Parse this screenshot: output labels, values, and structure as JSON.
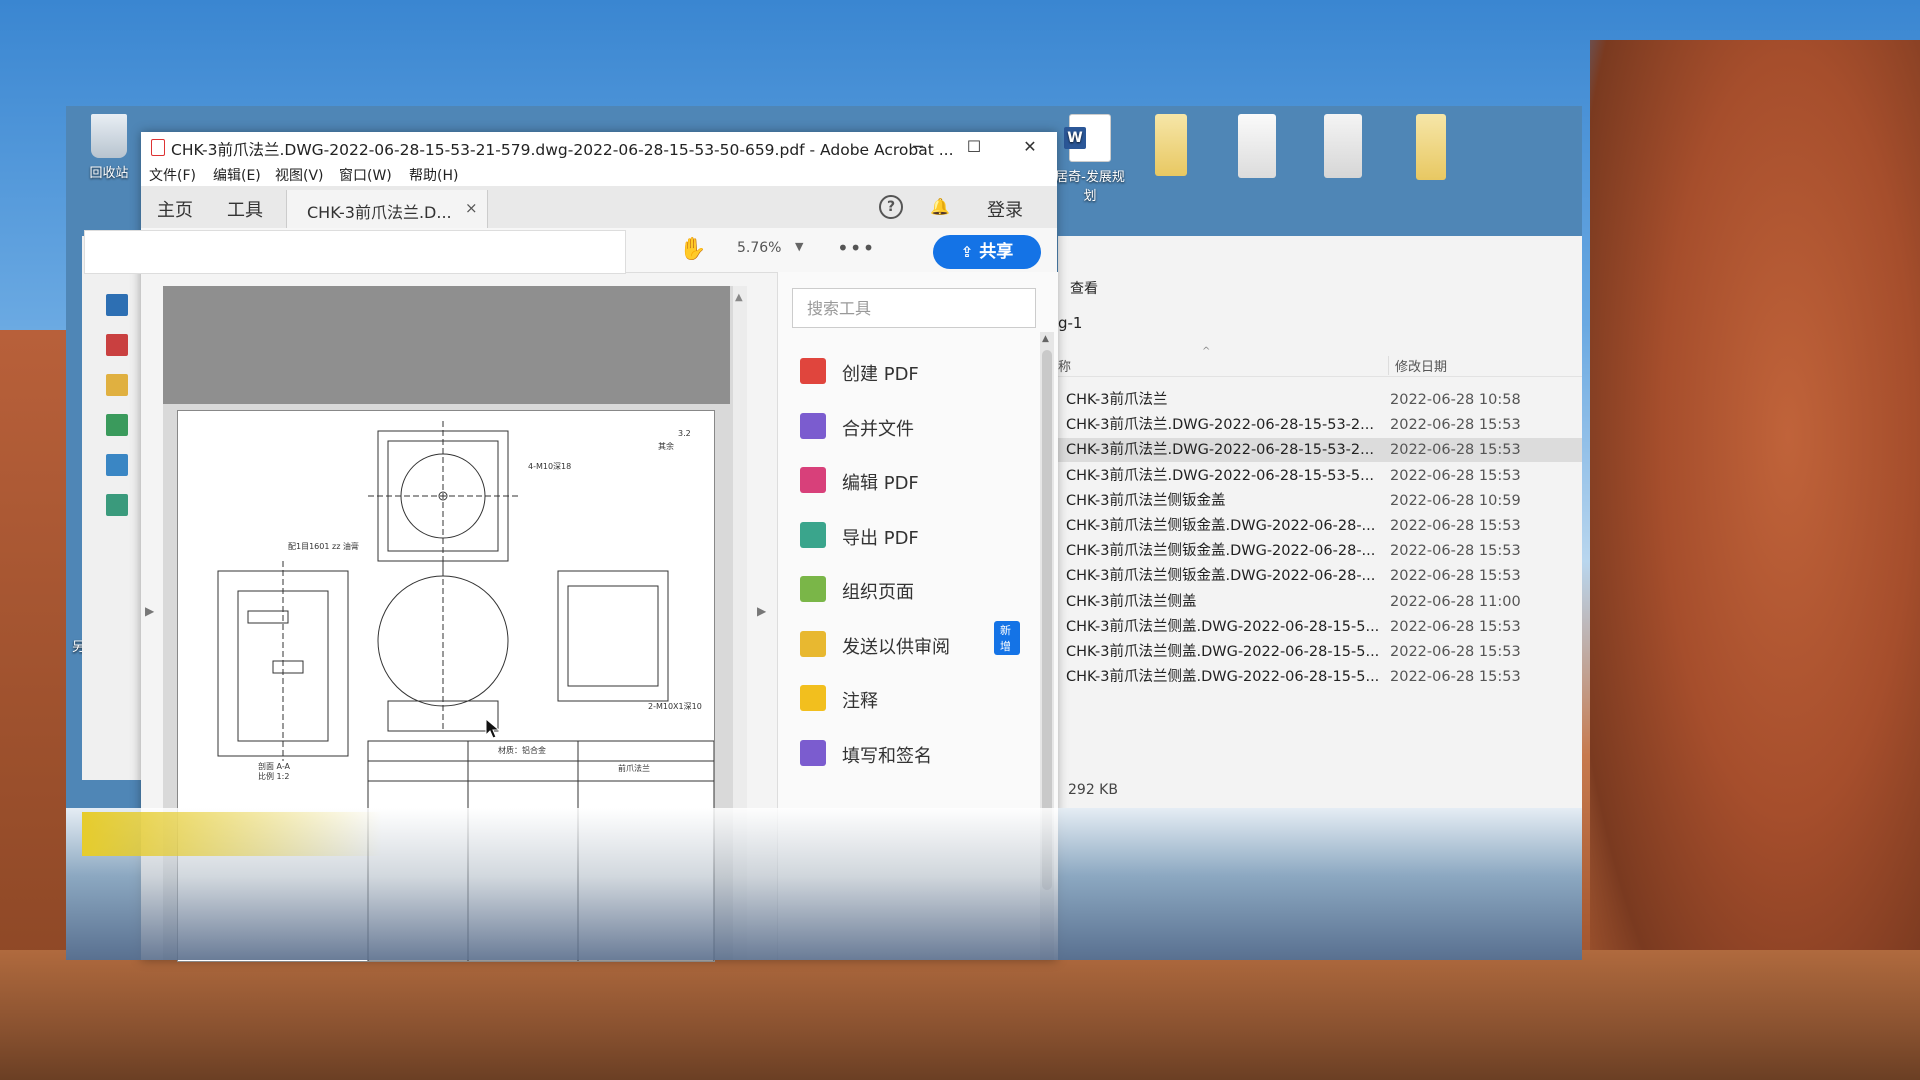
{
  "desktop": {
    "icons": [
      {
        "label": "回收站"
      },
      {
        "label": "居奇-发展规划"
      }
    ],
    "partial_label": "另"
  },
  "acrobat": {
    "window_title": "CHK-3前爪法兰.DWG-2022-06-28-15-53-21-579.dwg-2022-06-28-15-53-50-659.pdf - Adobe Acrobat ...",
    "menu": [
      "文件(F)",
      "编辑(E)",
      "视图(V)",
      "窗口(W)",
      "帮助(H)"
    ],
    "tabs": {
      "home": "主页",
      "tools": "工具",
      "doc": "CHK-3前爪法兰.D...",
      "close": "×"
    },
    "login": "登录",
    "help": "?",
    "toolbar": {
      "zoom": "5.76%",
      "more": "•••",
      "share": "共享"
    },
    "tools_pane": {
      "search_placeholder": "搜索工具",
      "new_badge": "新增",
      "items": [
        {
          "label": "创建 PDF",
          "color": "#e0453d"
        },
        {
          "label": "合并文件",
          "color": "#7b5ccf"
        },
        {
          "label": "编辑 PDF",
          "color": "#d8407a"
        },
        {
          "label": "导出 PDF",
          "color": "#3aa58c"
        },
        {
          "label": "组织页面",
          "color": "#7ab648"
        },
        {
          "label": "发送以供审阅",
          "color": "#e8b830"
        },
        {
          "label": "注释",
          "color": "#f2bf1e"
        },
        {
          "label": "填写和签名",
          "color": "#7b5ccf"
        }
      ]
    },
    "drawing_notes": {
      "n1": "4-M10深18",
      "n2": "2-M10X1深10",
      "n3": "剖面 A-A",
      "n4": "比例 1:2",
      "n5": "前爪法兰",
      "n6": "材质：铝合金",
      "n7": "其余",
      "n8": "配1目1601 zz 油膏",
      "n9": "3.2"
    }
  },
  "explorer": {
    "view_tab": "查看",
    "path_tail": "g-1",
    "col_name": "称",
    "col_date": "修改日期",
    "files": [
      {
        "name": "CHK-3前爪法兰",
        "date": "2022-06-28 10:58"
      },
      {
        "name": "CHK-3前爪法兰.DWG-2022-06-28-15-53-2...",
        "date": "2022-06-28 15:53"
      },
      {
        "name": "CHK-3前爪法兰.DWG-2022-06-28-15-53-2...",
        "date": "2022-06-28 15:53"
      },
      {
        "name": "CHK-3前爪法兰.DWG-2022-06-28-15-53-5...",
        "date": "2022-06-28 15:53"
      },
      {
        "name": "CHK-3前爪法兰侧钣金盖",
        "date": "2022-06-28 10:59"
      },
      {
        "name": "CHK-3前爪法兰侧钣金盖.DWG-2022-06-28-...",
        "date": "2022-06-28 15:53"
      },
      {
        "name": "CHK-3前爪法兰侧钣金盖.DWG-2022-06-28-...",
        "date": "2022-06-28 15:53"
      },
      {
        "name": "CHK-3前爪法兰侧钣金盖.DWG-2022-06-28-...",
        "date": "2022-06-28 15:53"
      },
      {
        "name": "CHK-3前爪法兰侧盖",
        "date": "2022-06-28 11:00"
      },
      {
        "name": "CHK-3前爪法兰侧盖.DWG-2022-06-28-15-5...",
        "date": "2022-06-28 15:53"
      },
      {
        "name": "CHK-3前爪法兰侧盖.DWG-2022-06-28-15-5...",
        "date": "2022-06-28 15:53"
      },
      {
        "name": "CHK-3前爪法兰侧盖.DWG-2022-06-28-15-5...",
        "date": "2022-06-28 15:53"
      }
    ],
    "size": "292 KB"
  }
}
